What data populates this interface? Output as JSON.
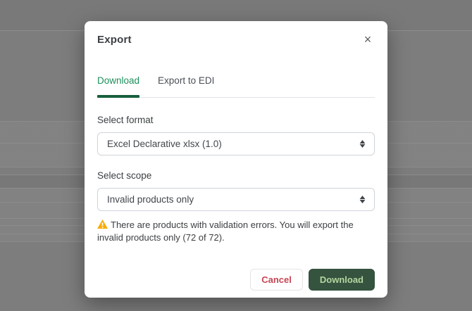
{
  "modal": {
    "title": "Export",
    "close": "×",
    "tabs": [
      {
        "label": "Download",
        "active": true
      },
      {
        "label": "Export to EDI",
        "active": false
      }
    ],
    "format_section": {
      "label": "Select format",
      "selected": "Excel Declarative xlsx (1.0)"
    },
    "scope_section": {
      "label": "Select scope",
      "selected": "Invalid products only"
    },
    "warning": {
      "icon": "warning-triangle-icon",
      "text": "There are products with validation errors. You will export the invalid products only (72 of 72)."
    },
    "actions": {
      "cancel_label": "Cancel",
      "download_label": "Download"
    }
  },
  "colors": {
    "active_tab_green": "#1d8f5b",
    "tab_underline_green": "#17603d",
    "download_button_bg": "#35533f",
    "download_button_text": "#b5d69f",
    "cancel_text_red": "#c64553",
    "warning_icon_orange": "#f9ab00",
    "select_border_gray": "#ced4da",
    "backdrop_gray": "#7d7d7d"
  }
}
